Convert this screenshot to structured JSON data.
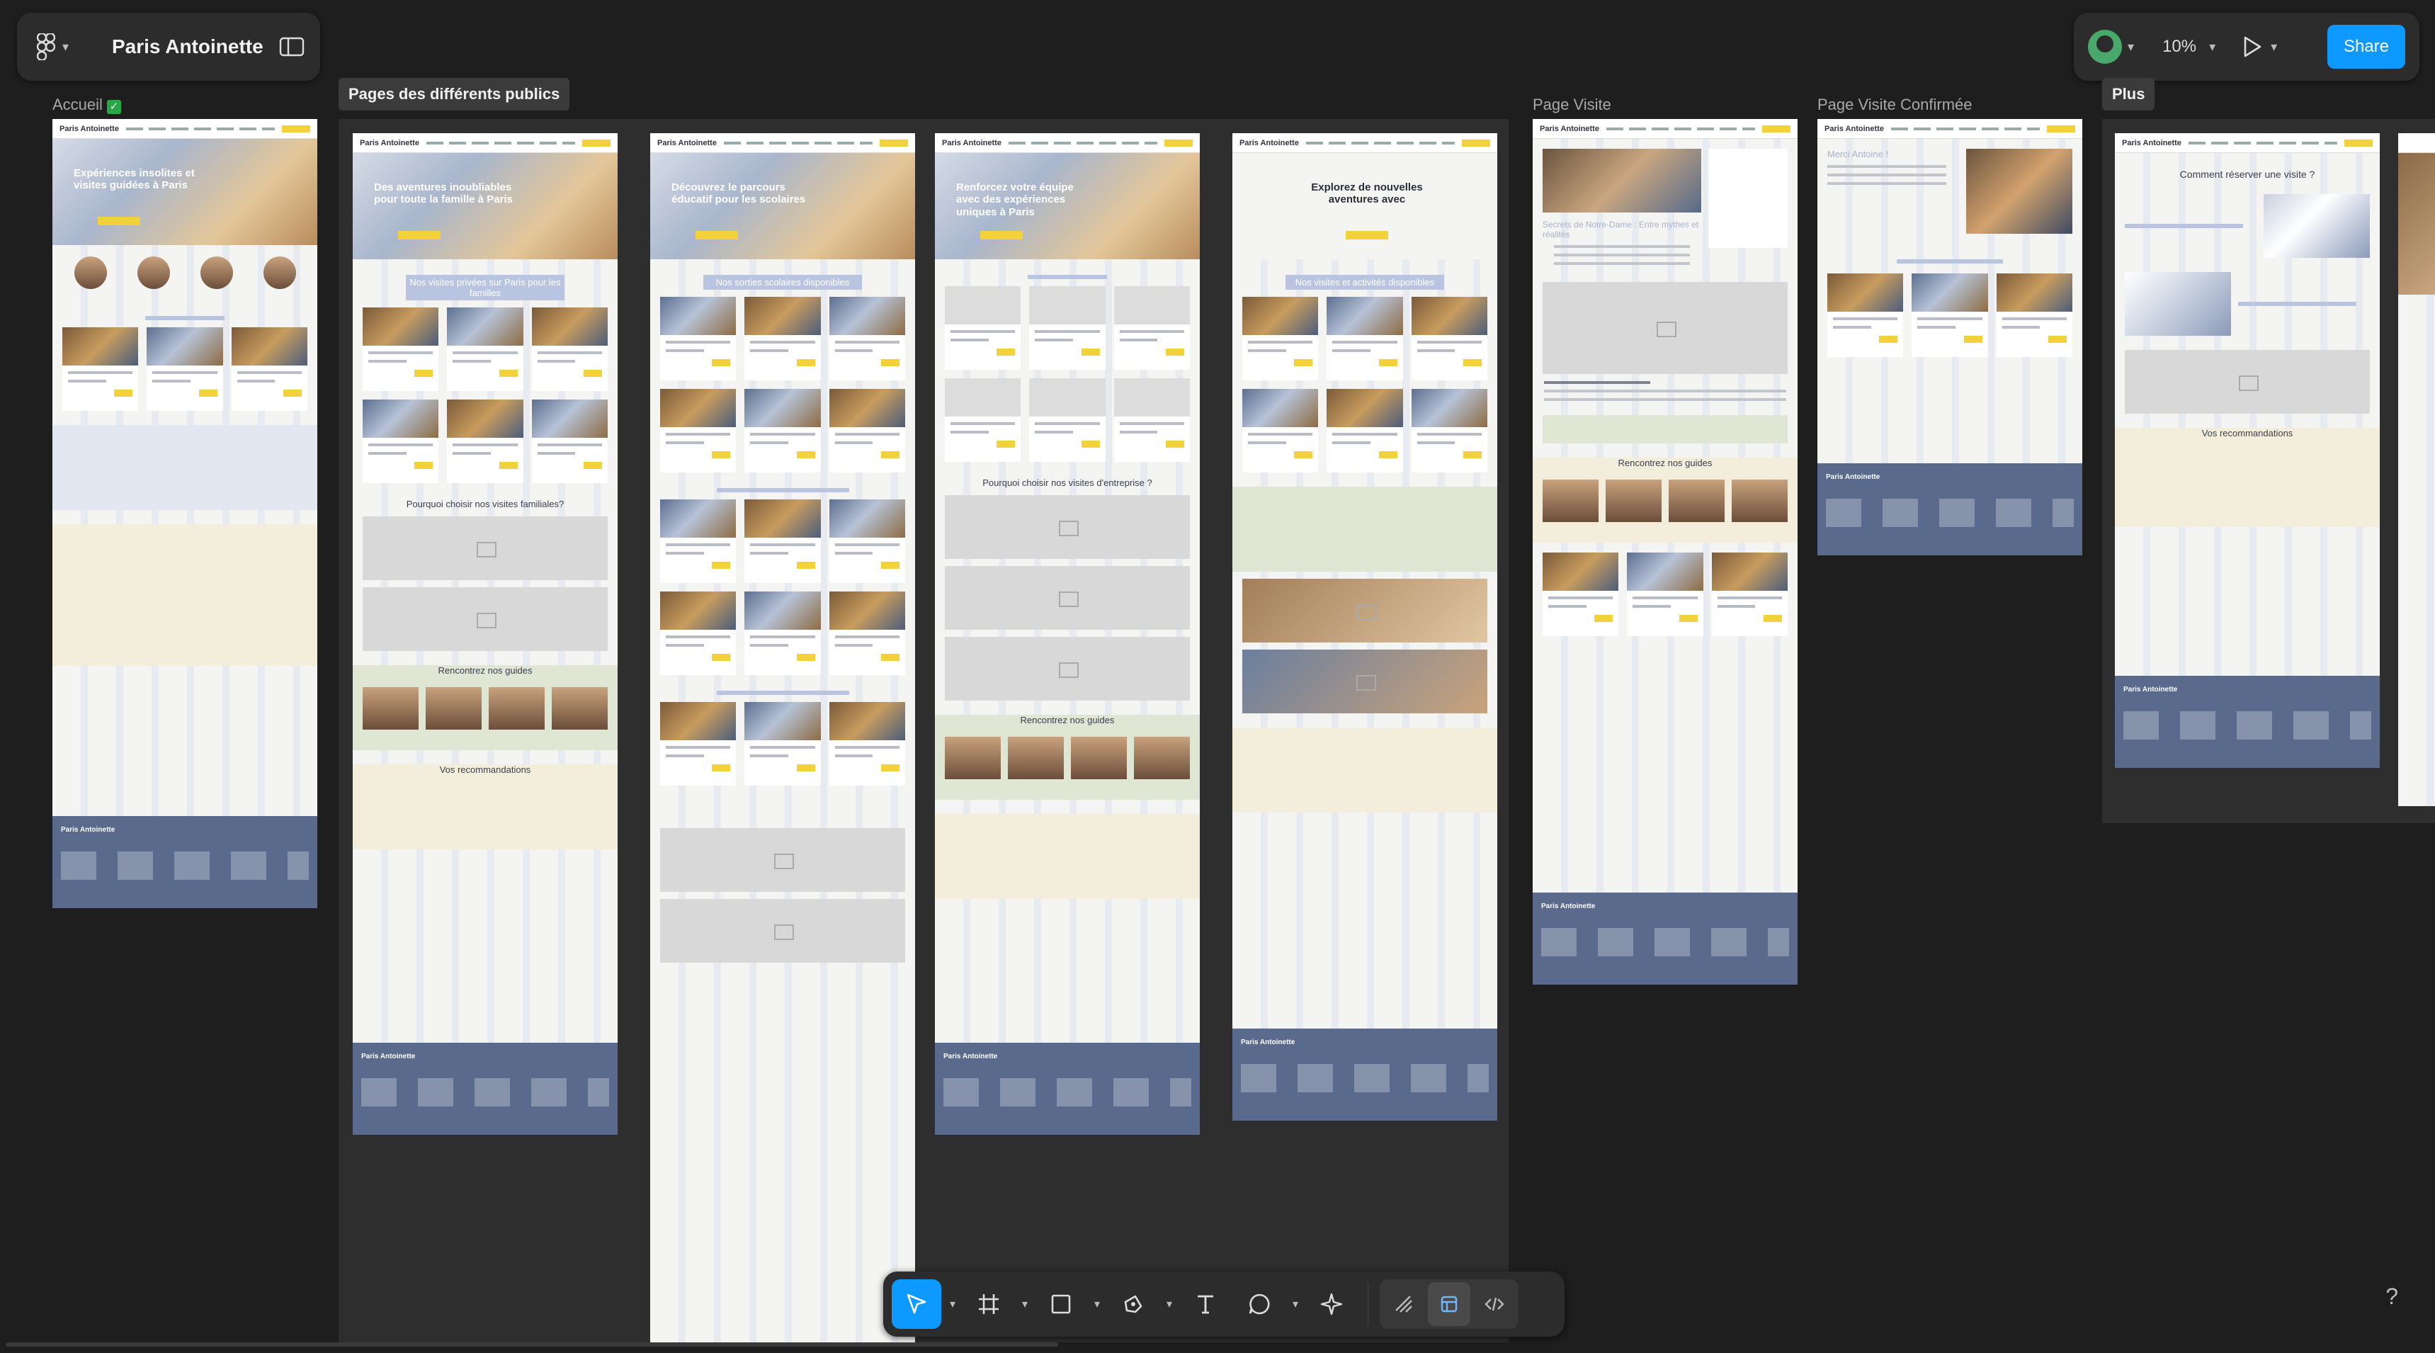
{
  "file": {
    "name": "Paris Antoinette"
  },
  "toolbar": {
    "zoom": "10%",
    "share_label": "Share"
  },
  "frames": {
    "accueil": "Accueil",
    "section_publics": "Pages des différents publics",
    "page_visite": "Page Visite",
    "page_visite_confirmee": "Page Visite Confirmée",
    "plus": "Plus"
  },
  "mockups": {
    "brand": "Paris Antoinette",
    "accueil_hero": "Expériences insolites et visites guidées à Paris",
    "familles_hero": "Des aventures inoubliables pour toute la famille à Paris",
    "familles_heading": "Nos visites privées sur Paris pour les familles",
    "familles_why": "Pourquoi choisir nos visites familiales?",
    "scolaires_hero": "Découvrez le parcours éducatif pour les scolaires",
    "scolaires_heading": "Nos sorties scolaires disponibles",
    "entreprise_hero": "Renforcez votre équipe avec des expériences uniques à Paris",
    "entreprise_why": "Pourquoi choisir nos visites d'entreprise ?",
    "seniors_hero": "Explorez de nouvelles aventures avec",
    "seniors_heading": "Nos visites et activités disponibles",
    "visite_hero": "Secrets de Notre-Dame : Entre mythes et réalités",
    "confirmee_title": "Merci Antoine !",
    "plus_title": "Comment réserver une visite ?",
    "guides": "Rencontrez nos guides",
    "recommendations": "Vos recommandations"
  }
}
